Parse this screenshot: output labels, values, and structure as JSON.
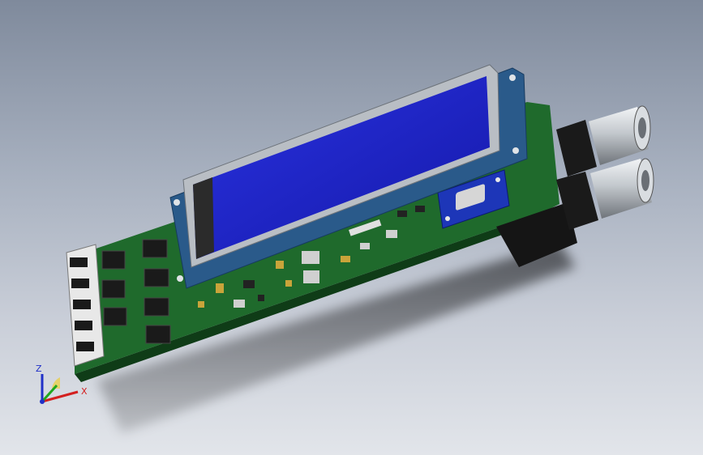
{
  "viewport": {
    "background_top": "#7f8a9c",
    "background_bottom": "#e2e5ea",
    "model": "pcb-assembly-with-lcd-and-bnc-connectors"
  },
  "colors": {
    "pcb": "#1f6a2c",
    "pcb_dark": "#0f3c17",
    "lcd_screen": "#1f23c8",
    "lcd_frame": "#2a5a8a",
    "bnc_metal": "#c8ccd0",
    "button_body": "#1a1a1a",
    "terminal_white": "#e8e8e8",
    "module_blue": "#1d36b8",
    "triad_x": "#d32020",
    "triad_y": "#1fa81f",
    "triad_z": "#2030c8"
  },
  "triad": {
    "x_label": "X",
    "z_label": "Z"
  }
}
